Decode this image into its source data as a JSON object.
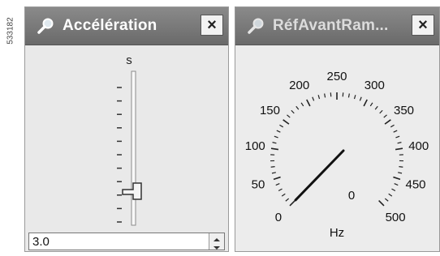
{
  "figure_ref": "533182",
  "left_panel": {
    "title": "Accélération",
    "title_icon": "magnifier-icon",
    "close_label": "×",
    "slider": {
      "unit": "s",
      "value": 3.0,
      "min": 0,
      "max": 10
    },
    "spin": {
      "value": "3.0"
    }
  },
  "right_panel": {
    "title": "RéfAvantRam...",
    "title_icon": "magnifier-icon",
    "close_label": "×",
    "gauge": {
      "unit": "Hz",
      "value": 0,
      "value_text": "0",
      "min": 0,
      "max": 500,
      "tick_labels": [
        "0",
        "50",
        "100",
        "150",
        "200",
        "250",
        "300",
        "350",
        "400",
        "450",
        "500"
      ],
      "needle_value": 0
    }
  }
}
